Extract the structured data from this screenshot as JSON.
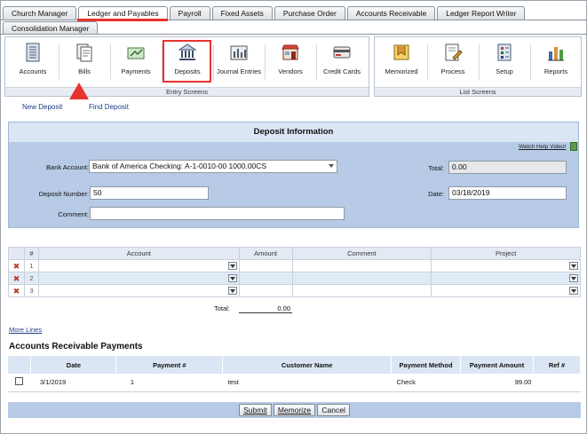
{
  "tabs_row1": [
    "Church Manager",
    "Ledger and Payables",
    "Payroll",
    "Fixed Assets",
    "Purchase Order",
    "Accounts Receivable",
    "Ledger Report Writer"
  ],
  "tabs_row2": [
    "Consolidation Manager"
  ],
  "toolbar": {
    "entry_items": [
      "Accounts",
      "Bills",
      "Payments",
      "Deposits",
      "Journal Entries",
      "Vendors",
      "Credit Cards"
    ],
    "entry_caption": "Entry Screens",
    "list_items": [
      "Memorized",
      "Process",
      "Setup",
      "Reports"
    ],
    "list_caption": "List Screens"
  },
  "links": {
    "new_deposit": "New Deposit",
    "find_deposit": "Find Deposit"
  },
  "deposit": {
    "title": "Deposit Information",
    "help_link": "Watch Help Video!",
    "bank_account_label": "Bank Account:",
    "bank_account_value": "Bank of America Checking: A-1-0010-00 1000.00CS",
    "deposit_number_label": "Deposit Number:",
    "deposit_number_value": "50",
    "comment_label": "Comment:",
    "comment_value": "",
    "total_label": "Total:",
    "total_value": "0.00",
    "date_label": "Date:",
    "date_value": "03/18/2019"
  },
  "lines": {
    "headers": [
      "#",
      "Account",
      "Amount",
      "Comment",
      "Project"
    ],
    "rows": [
      "1",
      "2",
      "3"
    ],
    "total_label": "Total:",
    "total_value": "0.00",
    "more_lines": "More Lines"
  },
  "ar": {
    "title": "Accounts Receivable Payments",
    "headers": [
      "Date",
      "Payment #",
      "Customer Name",
      "Payment Method",
      "Payment Amount",
      "Ref #"
    ],
    "rows": [
      {
        "date": "3/1/2019",
        "payment_no": "1",
        "customer": "test",
        "method": "Check",
        "amount": "99.00",
        "ref": ""
      }
    ]
  },
  "buttons": {
    "submit": "Submit",
    "memorize": "Memorize",
    "cancel": "Cancel"
  },
  "colors": {
    "panel": "#b7cbe6",
    "highlight": "#e8322c",
    "link": "#1f3f8a"
  }
}
